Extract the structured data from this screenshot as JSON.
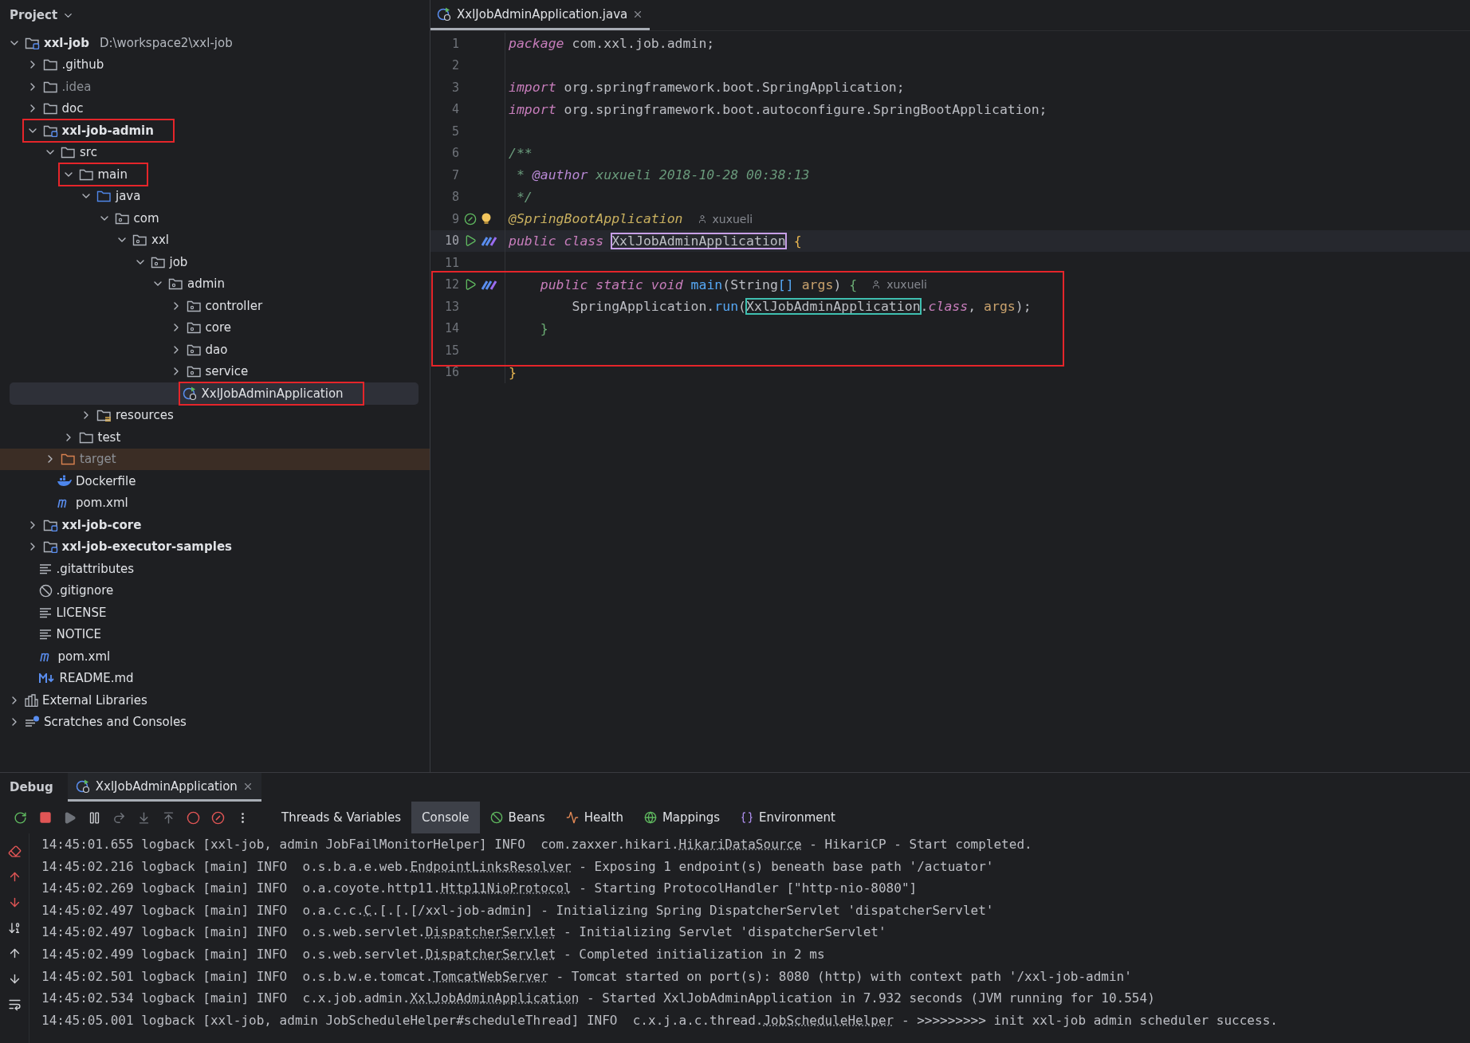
{
  "project_panel": {
    "title": "Project",
    "tree": [
      {
        "label": "xxl-job",
        "path": "D:\\workspace2\\xxl-job",
        "kind": "module",
        "expanded": true,
        "selected": false,
        "marked": false,
        "children": [
          {
            "label": ".github",
            "kind": "folder",
            "expanded": false,
            "selected": false,
            "marked": false
          },
          {
            "label": ".idea",
            "kind": "ignored-folder",
            "expanded": false,
            "selected": false,
            "marked": false
          },
          {
            "label": "doc",
            "kind": "folder",
            "expanded": false,
            "selected": false,
            "marked": false
          },
          {
            "label": "xxl-job-admin",
            "kind": "module",
            "expanded": true,
            "selected": false,
            "marked": true,
            "children": [
              {
                "label": "src",
                "kind": "folder",
                "expanded": true,
                "selected": false,
                "marked": false,
                "children": [
                  {
                    "label": "main",
                    "kind": "folder",
                    "expanded": true,
                    "selected": false,
                    "marked": true,
                    "children": [
                      {
                        "label": "java",
                        "kind": "source-folder",
                        "expanded": true,
                        "selected": false,
                        "marked": false,
                        "children": [
                          {
                            "label": "com",
                            "kind": "package",
                            "expanded": true,
                            "selected": false,
                            "marked": false,
                            "children": [
                              {
                                "label": "xxl",
                                "kind": "package",
                                "expanded": true,
                                "selected": false,
                                "marked": false,
                                "children": [
                                  {
                                    "label": "job",
                                    "kind": "package",
                                    "expanded": true,
                                    "selected": false,
                                    "marked": false,
                                    "children": [
                                      {
                                        "label": "admin",
                                        "kind": "package",
                                        "expanded": true,
                                        "selected": false,
                                        "marked": false,
                                        "children": [
                                          {
                                            "label": "controller",
                                            "kind": "package",
                                            "expanded": false,
                                            "selected": false,
                                            "marked": false
                                          },
                                          {
                                            "label": "core",
                                            "kind": "package",
                                            "expanded": false,
                                            "selected": false,
                                            "marked": false
                                          },
                                          {
                                            "label": "dao",
                                            "kind": "package",
                                            "expanded": false,
                                            "selected": false,
                                            "marked": false
                                          },
                                          {
                                            "label": "service",
                                            "kind": "package",
                                            "expanded": false,
                                            "selected": false,
                                            "marked": false
                                          },
                                          {
                                            "label": "XxlJobAdminApplication",
                                            "kind": "app-class",
                                            "selected": true,
                                            "marked": true
                                          }
                                        ]
                                      }
                                    ]
                                  }
                                ]
                              }
                            ]
                          }
                        ]
                      },
                      {
                        "label": "resources",
                        "kind": "resources",
                        "expanded": false,
                        "selected": false,
                        "marked": false
                      }
                    ]
                  },
                  {
                    "label": "test",
                    "kind": "folder",
                    "expanded": false,
                    "selected": false,
                    "marked": false
                  }
                ]
              },
              {
                "label": "target",
                "kind": "excluded-folder",
                "expanded": false,
                "selected": false,
                "marked": false
              },
              {
                "label": "Dockerfile",
                "kind": "docker",
                "selected": false,
                "marked": false
              },
              {
                "label": "pom.xml",
                "kind": "maven",
                "selected": false,
                "marked": false
              }
            ]
          },
          {
            "label": "xxl-job-core",
            "kind": "module",
            "expanded": false,
            "selected": false,
            "marked": false
          },
          {
            "label": "xxl-job-executor-samples",
            "kind": "module",
            "expanded": false,
            "selected": false,
            "marked": false
          },
          {
            "label": ".gitattributes",
            "kind": "text",
            "selected": false,
            "marked": false
          },
          {
            "label": ".gitignore",
            "kind": "ignore",
            "selected": false,
            "marked": false
          },
          {
            "label": "LICENSE",
            "kind": "text",
            "selected": false,
            "marked": false
          },
          {
            "label": "NOTICE",
            "kind": "text",
            "selected": false,
            "marked": false
          },
          {
            "label": "pom.xml",
            "kind": "maven",
            "selected": false,
            "marked": false
          },
          {
            "label": "README.md",
            "kind": "markdown",
            "selected": false,
            "marked": false
          }
        ]
      },
      {
        "label": "External Libraries",
        "kind": "library",
        "expanded": false,
        "selected": false,
        "marked": false
      },
      {
        "label": "Scratches and Consoles",
        "kind": "scratches",
        "expanded": false,
        "selected": false,
        "marked": false
      }
    ]
  },
  "editor": {
    "tabs": [
      {
        "label": "XxlJobAdminApplication.java",
        "selected": true
      }
    ],
    "lines": [
      {
        "number": "1",
        "kind": "plain",
        "current": false,
        "callout": false,
        "text": "package com.xxl.job.admin;"
      },
      {
        "number": "2",
        "kind": "plain",
        "current": false,
        "callout": false
      },
      {
        "number": "3",
        "kind": "plain",
        "current": false,
        "callout": false,
        "text": "import org.springframework.boot.SpringApplication;"
      },
      {
        "number": "4",
        "kind": "plain",
        "current": false,
        "callout": false,
        "text": "import org.springframework.boot.autoconfigure.SpringBootApplication;"
      },
      {
        "number": "5",
        "kind": "plain",
        "current": false,
        "callout": false
      },
      {
        "number": "6",
        "kind": "plain",
        "current": false,
        "callout": false,
        "text": "/**"
      },
      {
        "number": "7",
        "kind": "plain",
        "current": false,
        "callout": false,
        "text": " * @author xuxueli 2018-10-28 00:38:13"
      },
      {
        "number": "8",
        "kind": "plain",
        "current": false,
        "callout": false,
        "text": " */"
      },
      {
        "number": "9",
        "kind": "annotated",
        "current": false,
        "callout": false,
        "text": "@SpringBootApplication",
        "hint": "xuxueli"
      },
      {
        "number": "10",
        "kind": "runnable",
        "current": true,
        "callout": false,
        "text": "public class XxlJobAdminApplication {"
      },
      {
        "number": "11",
        "kind": "plain",
        "current": false,
        "callout": false
      },
      {
        "number": "12",
        "kind": "runnable",
        "current": false,
        "callout": true,
        "text": "    public static void main(String[] args) {",
        "hint": "xuxueli"
      },
      {
        "number": "13",
        "kind": "plain",
        "current": false,
        "callout": true,
        "text": "        SpringApplication.run(XxlJobAdminApplication.class, args);"
      },
      {
        "number": "14",
        "kind": "plain",
        "current": false,
        "callout": true,
        "text": "    }"
      },
      {
        "number": "15",
        "kind": "plain",
        "current": false,
        "callout": true
      },
      {
        "number": "16",
        "kind": "plain",
        "current": false,
        "callout": false,
        "text": "}"
      }
    ]
  },
  "debug_panel": {
    "title": "Debug",
    "session_tab": {
      "label": "XxlJobAdminApplication"
    },
    "tabs": [
      {
        "label": "Threads & Variables",
        "kind": "threads",
        "selected": false
      },
      {
        "label": "Console",
        "kind": "console",
        "selected": true
      },
      {
        "label": "Beans",
        "kind": "beans",
        "selected": false
      },
      {
        "label": "Health",
        "kind": "health",
        "selected": false
      },
      {
        "label": "Mappings",
        "kind": "mappings",
        "selected": false
      },
      {
        "label": "Environment",
        "kind": "environment",
        "selected": false
      }
    ],
    "console": [
      "14:45:01.655 logback [xxl-job, admin JobFailMonitorHelper] INFO  com.zaxxer.hikari.HikariDataSource - HikariCP - Start completed.",
      "14:45:02.216 logback [main] INFO  o.s.b.a.e.web.EndpointLinksResolver - Exposing 1 endpoint(s) beneath base path '/actuator'",
      "14:45:02.269 logback [main] INFO  o.a.coyote.http11.Http11NioProtocol - Starting ProtocolHandler [\"http-nio-8080\"]",
      "14:45:02.497 logback [main] INFO  o.a.c.c.C.[.[.[/xxl-job-admin] - Initializing Spring DispatcherServlet 'dispatcherServlet'",
      "14:45:02.497 logback [main] INFO  o.s.web.servlet.DispatcherServlet - Initializing Servlet 'dispatcherServlet'",
      "14:45:02.499 logback [main] INFO  o.s.web.servlet.DispatcherServlet - Completed initialization in 2 ms",
      "14:45:02.501 logback [main] INFO  o.s.b.w.e.tomcat.TomcatWebServer - Tomcat started on port(s): 8080 (http) with context path '/xxl-job-admin'",
      "14:45:02.534 logback [main] INFO  c.x.job.admin.XxlJobAdminApplication - Started XxlJobAdminApplication in 7.932 seconds (JVM running for 10.554)",
      "14:45:05.001 logback [xxl-job, admin JobScheduleHelper#scheduleThread] INFO  c.x.j.a.c.thread.JobScheduleHelper - >>>>>>>>> init xxl-job admin scheduler success."
    ]
  }
}
